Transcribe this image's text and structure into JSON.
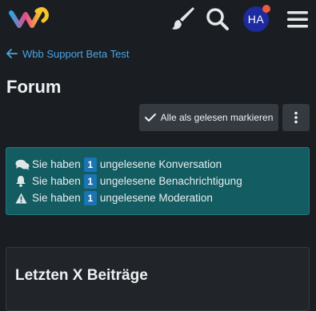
{
  "header": {
    "logo": "woltlab-logo",
    "icons": [
      "brush-icon",
      "search-icon",
      "menu-icon"
    ],
    "avatar_initials": "HA",
    "avatar_color": "#1e2aa0",
    "notification_dot_color": "#ee5a3c"
  },
  "breadcrumb": {
    "label": "Wbb Support Beta Test"
  },
  "page": {
    "title": "Forum"
  },
  "actions": {
    "mark_read_label": "Alle als gelesen markieren"
  },
  "notices": [
    {
      "icon": "comments-icon",
      "prefix": "Sie haben",
      "count": "1",
      "suffix": "ungelesene Konversation"
    },
    {
      "icon": "bell-icon",
      "prefix": "Sie haben",
      "count": "1",
      "suffix": "ungelesene Benachrichtigung"
    },
    {
      "icon": "warning-icon",
      "prefix": "Sie haben",
      "count": "1",
      "suffix": "ungelesene Moderation"
    }
  ],
  "box": {
    "title": "Letzten X Beiträge"
  },
  "colors": {
    "accent": "#49a6e4",
    "notice_bg": "#135c61",
    "badge": "#1b74b3"
  }
}
